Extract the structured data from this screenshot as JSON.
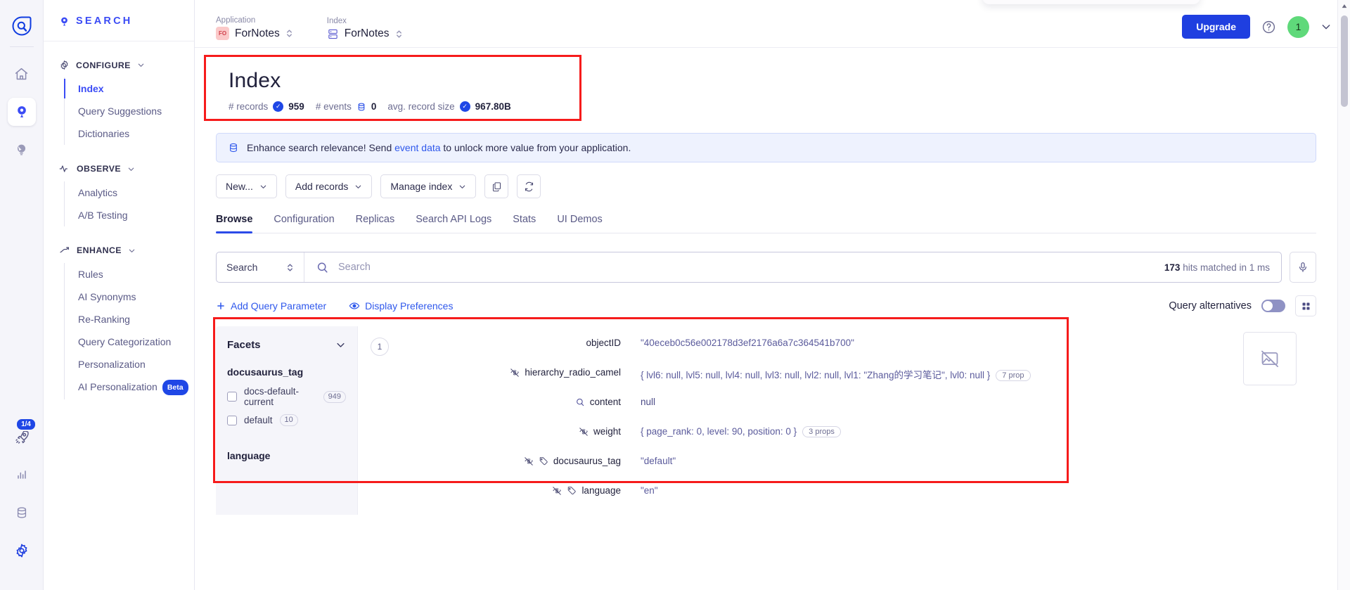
{
  "rail": {
    "logo_icon": "algolia-logo-icon",
    "items": [
      {
        "name": "home-icon",
        "active": false
      },
      {
        "name": "search-pin-icon",
        "active": true
      },
      {
        "name": "lightbulb-icon",
        "active": false
      }
    ],
    "bottom_items": [
      {
        "name": "rocket-icon",
        "badge": "1/4"
      },
      {
        "name": "bar-chart-icon",
        "badge": ""
      },
      {
        "name": "database-icon",
        "badge": ""
      },
      {
        "name": "gear-icon",
        "badge": ""
      }
    ]
  },
  "sidebar": {
    "brand": "SEARCH",
    "brand_icon": "search-pin-icon",
    "groups": [
      {
        "label": "CONFIGURE",
        "icon": "gear-icon",
        "items": [
          {
            "label": "Index",
            "active": true
          },
          {
            "label": "Query Suggestions",
            "active": false
          },
          {
            "label": "Dictionaries",
            "active": false
          }
        ]
      },
      {
        "label": "OBSERVE",
        "icon": "pulse-icon",
        "items": [
          {
            "label": "Analytics",
            "active": false
          },
          {
            "label": "A/B Testing",
            "active": false
          }
        ]
      },
      {
        "label": "ENHANCE",
        "icon": "trend-up-icon",
        "items": [
          {
            "label": "Rules",
            "active": false
          },
          {
            "label": "AI Synonyms",
            "active": false
          },
          {
            "label": "Re-Ranking",
            "active": false
          },
          {
            "label": "Query Categorization",
            "active": false
          },
          {
            "label": "Personalization",
            "active": false
          },
          {
            "label": "AI Personalization",
            "active": false,
            "badge": "Beta"
          }
        ]
      }
    ]
  },
  "topbar": {
    "application_label": "Application",
    "application_value": "ForNotes",
    "application_chip": "FO",
    "index_label": "Index",
    "index_value": "ForNotes",
    "upgrade_label": "Upgrade",
    "help_icon": "help-circle-icon",
    "avatar_initial": "1",
    "chevron_icon": "chevron-down-icon"
  },
  "page": {
    "title": "Index",
    "stats": [
      {
        "label": "# records",
        "value": "959",
        "icon": "check-circle-icon"
      },
      {
        "label": "# events",
        "value": "0",
        "icon": "database-icon"
      },
      {
        "label": "avg. record size",
        "value": "967.80B",
        "icon": "check-circle-icon"
      }
    ]
  },
  "banner": {
    "icon": "database-icon",
    "text_before": "Enhance search relevance! Send ",
    "link": "event data",
    "text_after": " to unlock more value from your application."
  },
  "toolbar": {
    "buttons": [
      {
        "label": "New...",
        "caret": true
      },
      {
        "label": "Add records",
        "caret": true
      },
      {
        "label": "Manage index",
        "caret": true
      }
    ],
    "copy_icon": "copy-icon",
    "refresh_icon": "refresh-icon"
  },
  "tabs": [
    {
      "label": "Browse",
      "active": true
    },
    {
      "label": "Configuration",
      "active": false
    },
    {
      "label": "Replicas",
      "active": false
    },
    {
      "label": "Search API Logs",
      "active": false
    },
    {
      "label": "Stats",
      "active": false
    },
    {
      "label": "UI Demos",
      "active": false
    }
  ],
  "search": {
    "scope_value": "Search",
    "placeholder": "Search",
    "search_icon": "search-icon",
    "hits_count": "173",
    "hits_text": "hits matched in 1 ms",
    "mic_icon": "microphone-icon"
  },
  "prefs": {
    "add_query_parameter": "Add Query Parameter",
    "add_icon": "plus-icon",
    "display_preferences": "Display Preferences",
    "eye_icon": "eye-icon",
    "query_alternatives": "Query alternatives",
    "toggle_on": false,
    "grid_icon": "grid-view-icon"
  },
  "facets": {
    "title": "Facets",
    "collapse_icon": "chevron-down-icon",
    "groups": [
      {
        "name": "docusaurus_tag",
        "values": [
          {
            "label": "docs-default-current",
            "count": "949",
            "checked": false
          },
          {
            "label": "default",
            "count": "10",
            "checked": false
          }
        ]
      },
      {
        "name": "language",
        "values": []
      }
    ]
  },
  "record": {
    "index": "1",
    "thumbnail_icon": "image-off-icon",
    "attributes": [
      {
        "icon": "",
        "key": "objectID",
        "value": "\"40eceb0c56e002178d3ef2176a6a7c364541b700\"",
        "pill": ""
      },
      {
        "icon": "eye-off-icon",
        "key": "hierarchy_radio_camel",
        "value": "{ lvl6: null, lvl5: null, lvl4: null, lvl3: null, lvl2: null, lvl1: \"Zhang的学习笔记\", lvl0: null }",
        "pill": "7 prop"
      },
      {
        "icon": "search-icon",
        "key": "content",
        "value": "null",
        "pill": ""
      },
      {
        "icon": "eye-off-icon",
        "key": "weight",
        "value": "{ page_rank: 0, level: 90, position: 0 }",
        "pill": "3 props"
      },
      {
        "icon": "eye-off-icon,tag-icon",
        "key": "docusaurus_tag",
        "value": "\"default\"",
        "pill": ""
      },
      {
        "icon": "eye-off-icon,tag-icon",
        "key": "language",
        "value": "\"en\"",
        "pill": ""
      }
    ]
  },
  "colors": {
    "accent": "#3b4cf5",
    "upgrade": "#1f3fe0",
    "highlight": "#f61b1b",
    "avatar": "#5fd97a"
  }
}
